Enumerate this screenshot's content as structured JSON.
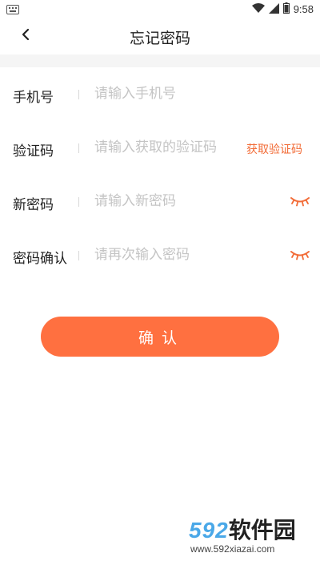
{
  "status_bar": {
    "time": "9:58",
    "icons": [
      "keyboard-icon",
      "wifi-icon",
      "signal-icon",
      "battery-icon"
    ]
  },
  "header": {
    "title": "忘记密码",
    "back_icon": "chevron-left-icon"
  },
  "form": {
    "phone": {
      "label": "手机号",
      "placeholder": "请输入手机号"
    },
    "code": {
      "label": "验证码",
      "placeholder": "请输入获取的验证码",
      "action_label": "获取验证码"
    },
    "new_password": {
      "label": "新密码",
      "placeholder": "请输入新密码",
      "toggle_icon": "eye-closed-icon"
    },
    "confirm_password": {
      "label": "密码确认",
      "placeholder": "请再次输入密码",
      "toggle_icon": "eye-closed-icon"
    }
  },
  "confirm_button": {
    "label": "确认"
  },
  "watermark": {
    "logo_number": "592",
    "logo_text": "软件园",
    "url": "www.592xiazai.com"
  },
  "colors": {
    "accent": "#ff7040",
    "link": "#f26b36",
    "placeholder": "#c4c4c4",
    "band": "#f5f5f5"
  }
}
